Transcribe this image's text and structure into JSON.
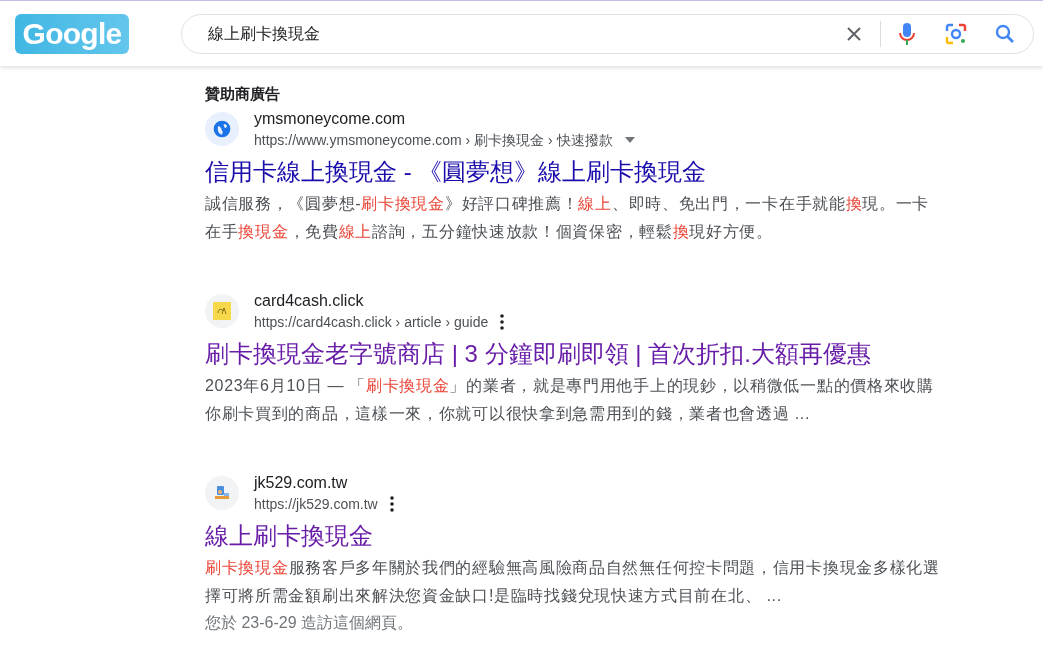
{
  "header": {
    "logo": "Google",
    "search": {
      "value": "線上刷卡換現金"
    }
  },
  "sponsored_label": "贊助商廣告",
  "results": [
    {
      "favicon": {
        "kind": "globe"
      },
      "site": "ymsmoneycome.com",
      "url": "https://www.ymsmoneycome.com › 刷卡換現金 › 快速撥款",
      "menu": {
        "kind": "caret"
      },
      "title": "信用卡線上換現金 - 《圓夢想》線上刷卡換現金",
      "visited": false,
      "snippet": [
        {
          "text": "誠信服務，《圓夢想-",
          "highlight": false
        },
        {
          "text": "刷卡換現金",
          "highlight": true
        },
        {
          "text": "》好評口碑推薦！",
          "highlight": false
        },
        {
          "text": "線上",
          "highlight": true
        },
        {
          "text": "、即時、免出門，一卡在手就能",
          "highlight": false
        },
        {
          "text": "換",
          "highlight": true
        },
        {
          "text": "現。一卡在手",
          "highlight": false
        },
        {
          "text": "換現金",
          "highlight": true
        },
        {
          "text": "，免費",
          "highlight": false
        },
        {
          "text": "線上",
          "highlight": true
        },
        {
          "text": "諮詢，五分鐘快速放款！個資保密，輕鬆",
          "highlight": false
        },
        {
          "text": "換",
          "highlight": true
        },
        {
          "text": "現好方便。",
          "highlight": false
        }
      ]
    },
    {
      "favicon": {
        "kind": "yellow"
      },
      "site": "card4cash.click",
      "url": "https://card4cash.click › article › guide",
      "menu": {
        "kind": "dots"
      },
      "title": "刷卡換現金老字號商店 | 3 分鐘即刷即領 | 首次折扣.大額再優惠",
      "visited": true,
      "snippet": [
        {
          "text": "2023年6月10日 — 「",
          "highlight": false
        },
        {
          "text": "刷卡換現金",
          "highlight": true
        },
        {
          "text": "」的業者，就是專門用他手上的現鈔，以稍微低一點的價格來收購你刷卡買到的商品，這樣一來，你就可以很快拿到急需用到的錢，業者也會透過 ...",
          "highlight": false
        }
      ]
    },
    {
      "favicon": {
        "kind": "figure"
      },
      "site": "jk529.com.tw",
      "url": "https://jk529.com.tw",
      "menu": {
        "kind": "dots"
      },
      "title": "線上刷卡換現金",
      "visited": true,
      "snippet": [
        {
          "text": "刷卡換現金",
          "highlight": true
        },
        {
          "text": "服務客戶多年關於我們的經驗無高風險商品自然無任何控卡問題，信用卡換現金多樣化選擇可將所需金額刷出來解決您資金缺口!是臨時找錢兌現快速方式目前在北、 ...",
          "highlight": false
        }
      ],
      "visit_note": "您於 23-6-29 造訪這個網頁。"
    }
  ]
}
